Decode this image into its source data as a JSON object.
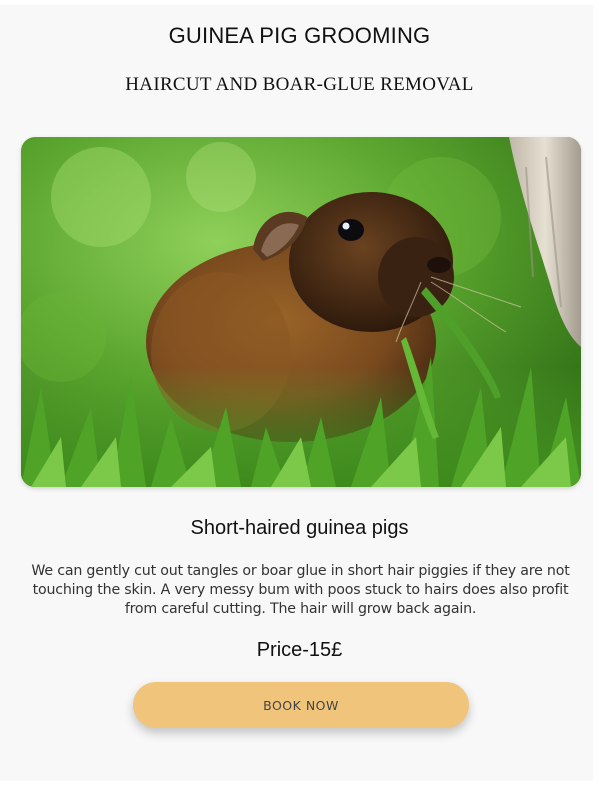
{
  "header": {
    "title": "GUINEA PIG GROOMING",
    "subtitle": "HAIRCUT AND BOAR-GLUE REMOVAL"
  },
  "service": {
    "image_icon": "guinea-pig-photo",
    "title": "Short-haired guinea pigs",
    "description": "We can gently cut out tangles or boar glue in short hair piggies if they are not touching the skin. A very messy bum with poos stuck to hairs does also profit from careful cutting. The hair will grow back again.",
    "price": "Price-15£",
    "button_label": "BOOK NOW"
  },
  "colors": {
    "button_bg": "#f0c47a",
    "page_bg": "#f8f8f8",
    "grass": "#4f9a2a",
    "fur": "#7a4a1e"
  }
}
